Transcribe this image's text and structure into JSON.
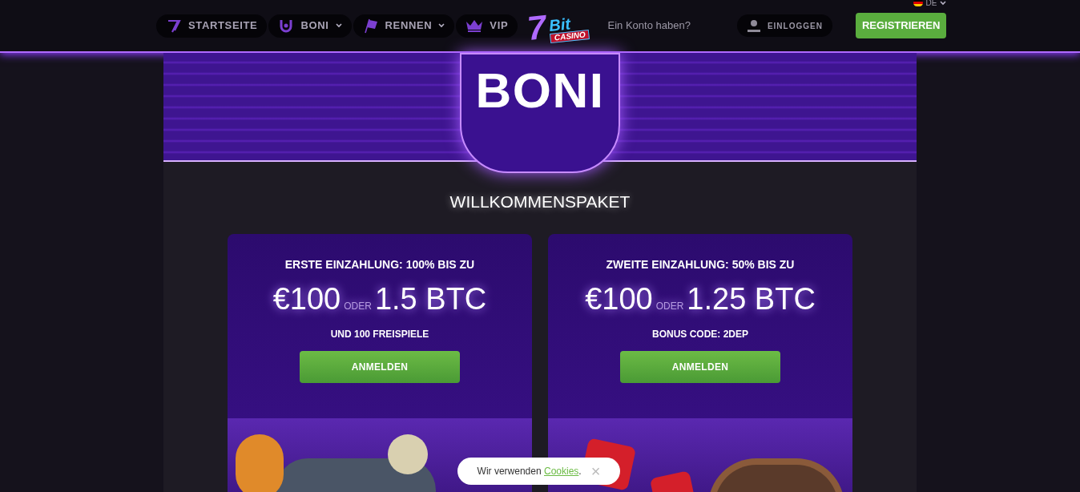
{
  "nav": [
    {
      "kind": "home",
      "label": "STARTSEITE",
      "dropdown": false
    },
    {
      "kind": "bonus",
      "label": "BONI",
      "dropdown": true
    },
    {
      "kind": "race",
      "label": "RENNEN",
      "dropdown": true
    },
    {
      "kind": "vip",
      "label": "VIP",
      "dropdown": false
    }
  ],
  "logo": {
    "number": "7",
    "word": "Bit",
    "sub": "CASINO"
  },
  "account_prompt": "Ein Konto haben?",
  "login": "EINLOGGEN",
  "register": "REGISTRIEREN",
  "language": "DE",
  "hero_title": "BONI",
  "section_title": "WILLKOMMENSPAKET",
  "offers": [
    {
      "kind": "cars",
      "heading": "ERSTE EINZAHLUNG: 100% BIS ZU",
      "amount": "€100",
      "or": "ODER",
      "crypto": "1.5 BTC",
      "note": "UND 100 FREISPIELE",
      "button": "ANMELDEN"
    },
    {
      "kind": "roulette",
      "heading": "ZWEITE EINZAHLUNG: 50% BIS ZU",
      "amount": "€100",
      "or": "ODER",
      "crypto": "1.25 BTC",
      "note": "BONUS CODE: 2DEP",
      "button": "ANMELDEN"
    }
  ],
  "cookie": {
    "before": "Wir verwenden ",
    "link": "Cookies",
    "after": ".",
    "close": "×"
  }
}
